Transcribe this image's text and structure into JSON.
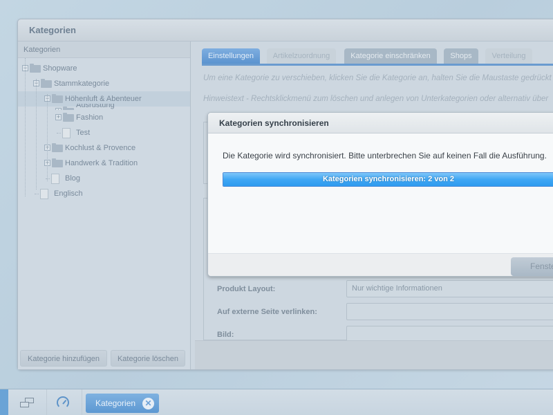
{
  "window": {
    "title": "Kategorien"
  },
  "sidebar": {
    "header": "Kategorien",
    "tree": [
      {
        "label": "Shopware",
        "level": 0,
        "type": "folder",
        "expanded": true
      },
      {
        "label": "Stammkategorie",
        "level": 1,
        "type": "folder",
        "expanded": true
      },
      {
        "label": "Höhenluft & Abenteuer",
        "level": 2,
        "type": "folder",
        "expanded": true,
        "selected": true
      },
      {
        "label": "Ausrüstung",
        "level": 3,
        "type": "folder",
        "expanded": false,
        "obscured": true
      },
      {
        "label": "Fashion",
        "level": 3,
        "type": "folder",
        "expanded": false
      },
      {
        "label": "Test",
        "level": 3,
        "type": "leaf"
      },
      {
        "label": "Kochlust & Provence",
        "level": 2,
        "type": "folder",
        "expanded": false
      },
      {
        "label": "Handwerk & Tradition",
        "level": 2,
        "type": "folder",
        "expanded": false
      },
      {
        "label": "Blog",
        "level": 2,
        "type": "leaf"
      },
      {
        "label": "Englisch",
        "level": 1,
        "type": "leaf"
      }
    ],
    "add_button": "Kategorie hinzufügen",
    "delete_button": "Kategorie löschen"
  },
  "main": {
    "tabs": [
      {
        "label": "Einstellungen",
        "state": "active"
      },
      {
        "label": "Artikelzuordnung",
        "state": "disabled"
      },
      {
        "label": "Kategorie einschränken",
        "state": "normal"
      },
      {
        "label": "Shops",
        "state": "normal"
      },
      {
        "label": "Verteilung",
        "state": "disabled"
      }
    ],
    "hint1": "Um eine Kategorie zu verschieben, klicken Sie die Kategorie an, halten Sie die Maustaste gedrückt",
    "hint2": "Hinweistext - Rechtsklickmenü zum löschen und anlegen von Unterkategorien oder alternativ über",
    "form": {
      "product_layout_label": "Produkt Layout:",
      "product_layout_value": "Nur wichtige Informationen",
      "external_link_label": "Auf externe Seite verlinken:",
      "external_link_value": "",
      "image_label": "Bild:",
      "image_value": ""
    }
  },
  "modal": {
    "title": "Kategorien synchronisieren",
    "message": "Die Kategorie wird synchronisiert. Bitte unterbrechen Sie auf keinen Fall die Ausführung.",
    "progress_text": "Kategorien synchronisieren: 2 von 2",
    "progress_fraction": 1.0,
    "close_button": "Fenster schließen"
  },
  "taskbar": {
    "windows_icon": "windows-icon",
    "dashboard_icon": "dashboard-icon",
    "active_tab": "Kategorien",
    "close_glyph": "✕"
  },
  "colors": {
    "accent": "#5b93cf",
    "progress": "#3fa7f4"
  }
}
